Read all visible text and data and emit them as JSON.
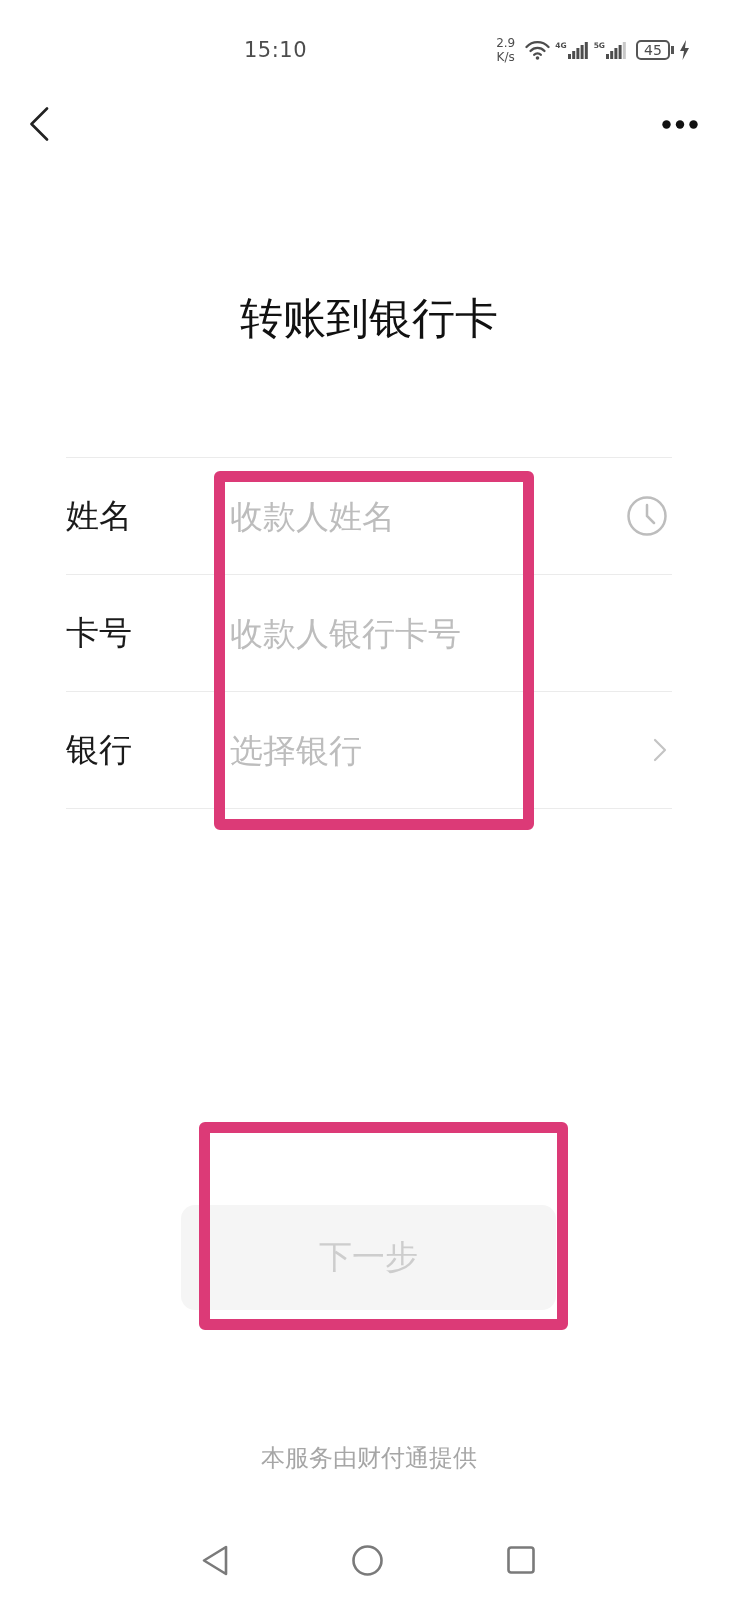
{
  "status_bar": {
    "time": "15:10",
    "net_speed": "2.9",
    "net_speed_unit": "K/s",
    "networks": [
      {
        "type": "4G"
      },
      {
        "type": "5G"
      }
    ],
    "battery": "45",
    "charging": true
  },
  "title": "转账到银行卡",
  "form": {
    "highlighted": true,
    "fields": [
      {
        "label": "姓名",
        "placeholder": "收款人姓名",
        "kind": "history"
      },
      {
        "label": "卡号",
        "placeholder": "收款人银行卡号",
        "kind": "plain"
      },
      {
        "label": "银行",
        "placeholder": "选择银行",
        "kind": "picker"
      }
    ]
  },
  "next_button": {
    "label": "下一步",
    "disabled": true,
    "highlighted": true
  },
  "footer": "本服务由财付通提供"
}
